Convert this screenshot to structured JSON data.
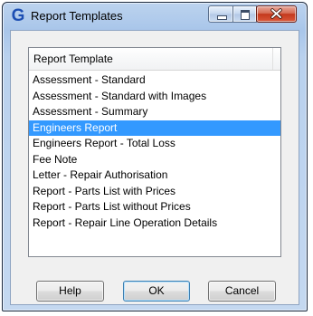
{
  "window": {
    "title": "Report Templates",
    "app_icon_glyph": "G",
    "icon": "app-icon"
  },
  "list": {
    "column_header": "Report Template",
    "selected_index": 3,
    "items": [
      "Assessment - Standard",
      "Assessment - Standard with Images",
      "Assessment - Summary",
      "Engineers Report",
      "Engineers Report - Total Loss",
      "Fee Note",
      "Letter - Repair Authorisation",
      "Report - Parts List with Prices",
      "Report - Parts List without Prices",
      "Report - Repair Line Operation Details"
    ]
  },
  "buttons": {
    "help_label": "Help",
    "ok_label": "OK",
    "cancel_label": "Cancel"
  },
  "colors": {
    "selection": "#3399ff",
    "close_button": "#c4391d",
    "icon_blue": "#1d4fb3"
  }
}
